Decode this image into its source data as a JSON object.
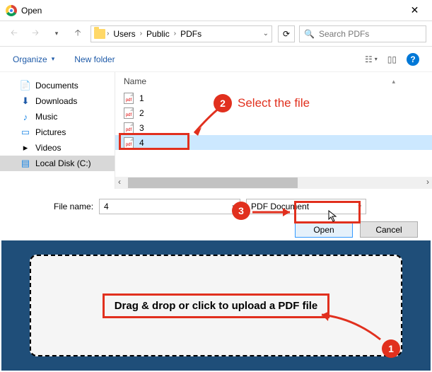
{
  "window": {
    "title": "Open"
  },
  "breadcrumb": {
    "parts": [
      "Users",
      "Public",
      "PDFs"
    ]
  },
  "search": {
    "placeholder": "Search PDFs"
  },
  "toolbar": {
    "organize": "Organize",
    "newfolder": "New folder"
  },
  "sidebar": {
    "items": [
      {
        "label": "Documents",
        "icon": "📄"
      },
      {
        "label": "Downloads",
        "icon": "⬇"
      },
      {
        "label": "Music",
        "icon": "♪"
      },
      {
        "label": "Pictures",
        "icon": "▭"
      },
      {
        "label": "Videos",
        "icon": "▸"
      },
      {
        "label": "Local Disk (C:)",
        "icon": "▤"
      }
    ]
  },
  "filelist": {
    "header": "Name",
    "files": [
      "1",
      "2",
      "3",
      "4"
    ],
    "selected": "4"
  },
  "filename": {
    "label": "File name:",
    "value": "4"
  },
  "filter": {
    "value": "PDF Document"
  },
  "buttons": {
    "open": "Open",
    "cancel": "Cancel"
  },
  "dropzone": {
    "text": "Drag & drop or click to upload a PDF file"
  },
  "annotations": {
    "step1": "1",
    "step2": "2",
    "step2_text": "Select the file",
    "step3": "3"
  }
}
